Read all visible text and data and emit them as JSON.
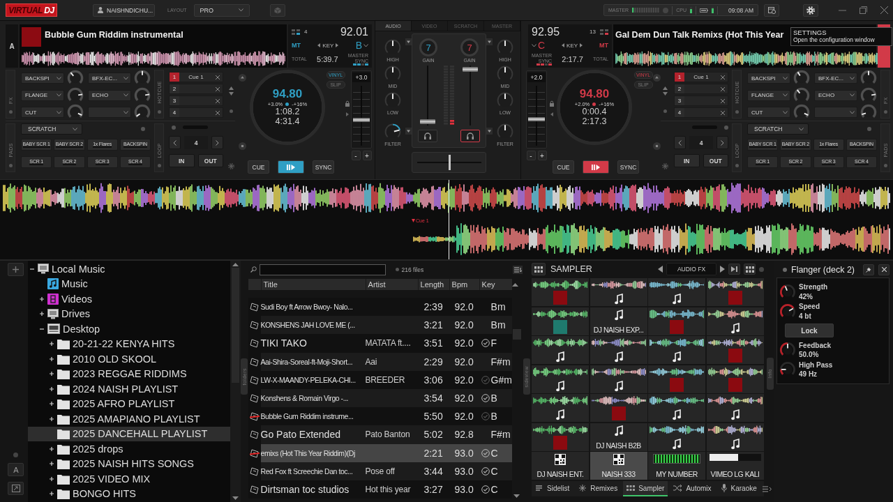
{
  "top_bar": {
    "logo": {
      "main": "VIRTUAL",
      "accent": "DJ"
    },
    "user": "NAISHNDICHU...",
    "layout_label": "LAYOUT",
    "layout": "PRO",
    "master_label": "MASTER",
    "cpu_label": "CPU",
    "time": "09:08 AM",
    "tooltip": {
      "title": "SETTINGS",
      "text": "Open the configuration window"
    }
  },
  "decks": [
    {
      "letter": "A",
      "color": "#2f9fc4",
      "selected": false,
      "cover": true,
      "title": "Bubble Gum Riddim instrumental",
      "beats": "4",
      "bpm": "92.01",
      "mt": "MT",
      "key_label": "KEY",
      "key": "B",
      "total_label": "TOTAL",
      "total": "5:39.7",
      "master_label": "MASTER",
      "sync_label": "SYNC",
      "fx_label": "FX",
      "fx": [
        {
          "name": "BACKSPI",
          "level": 0.35
        },
        {
          "name": "BFX-EC...",
          "level": 0.5
        },
        {
          "name": "FLANGE",
          "level": 0.8
        },
        {
          "name": "ECHO",
          "level": 0.8
        },
        {
          "name": "CUT",
          "level": 0.92
        },
        {
          "level": 0.04
        }
      ],
      "hotcue_label": "HOTCUE",
      "hotcues": [
        {
          "number": "1",
          "label": "Cue 1",
          "set": true
        },
        {
          "number": "2",
          "set": false
        },
        {
          "number": "3",
          "set": false
        },
        {
          "number": "4",
          "set": false
        }
      ],
      "pads_label": "PADS",
      "pad_mode": "SCRATCH",
      "pads": [
        "BABY SCR 1",
        "BABY SCR 2",
        "1x Flares",
        "BACKSPIN",
        "SCR 1",
        "SCR 2",
        "SCR 3",
        "SCR 4"
      ],
      "loop_label": "LOOP",
      "loop_size": "4",
      "loop_in": "IN",
      "loop_out": "OUT",
      "jog": {
        "bpm": "94.80",
        "pitch": "+3.0%",
        "range": "-+16%",
        "elapsed": "1:08.2",
        "remain": "4:31.4"
      },
      "vinyl": {
        "label": "VINYL",
        "on": true
      },
      "slip": {
        "label": "SLIP",
        "on": false
      },
      "pitch_fader": {
        "value": "+3.0",
        "level": 0.42
      },
      "pitch_minus": "-",
      "pitch_plus": "+",
      "cue": "CUE",
      "sync": "SYNC",
      "playing": true
    },
    {
      "color": "#d23a48",
      "selected": true,
      "cover": false,
      "title": "Gal Dem Dun Talk Remixs (Hot This Year",
      "beats": "13",
      "bpm": "92.95",
      "mt": "MT",
      "key_label": "KEY",
      "key": "C",
      "total_label": "TOTAL",
      "total": "2:17.7",
      "master_label": "MASTER",
      "sync_label": "SYNC",
      "fx_label": "FX",
      "fx": [
        {
          "name": "BACKSPI",
          "level": 0.38
        },
        {
          "name": "BFX-EC...",
          "level": 0.5
        },
        {
          "name": "FLANGE",
          "level": 0.36
        },
        {
          "name": "ECHO",
          "level": 0.8
        },
        {
          "name": "CUT",
          "level": 0.92
        },
        {
          "level": 0.1
        }
      ],
      "hotcue_label": "HOTCUE",
      "hotcues": [
        {
          "number": "1",
          "label": "Cue 1",
          "set": true
        },
        {
          "number": "2",
          "set": false
        },
        {
          "number": "3",
          "set": false
        },
        {
          "number": "4",
          "set": false
        }
      ],
      "pads_label": "PADS",
      "pad_mode": "SCRATCH",
      "pads": [
        "BABY SCR 1",
        "BABY SCR 2",
        "1x Flares",
        "BACKSPIN",
        "SCR 1",
        "SCR 2",
        "SCR 3",
        "SCR 4"
      ],
      "loop_label": "LOOP",
      "loop_size": "4",
      "loop_in": "IN",
      "loop_out": "OUT",
      "jog": {
        "bpm": "94.80",
        "pitch": "+2.0%",
        "range": "-+16%",
        "elapsed": "0:00.4",
        "remain": "2:17.3"
      },
      "vinyl": {
        "label": "VINYL",
        "on": true
      },
      "slip": {
        "label": "SLIP",
        "on": false
      },
      "pitch_fader": {
        "value": "+2.0",
        "level": 0.44
      },
      "pitch_minus": "-",
      "pitch_plus": "+",
      "cue": "CUE",
      "sync": "SYNC",
      "playing": true
    }
  ],
  "mixer": {
    "tabs": [
      {
        "label": "AUDIO",
        "selected": true
      },
      {
        "label": "VIDEO",
        "selected": false
      },
      {
        "label": "SCRATCH",
        "selected": false
      },
      {
        "label": "MASTER",
        "selected": false
      }
    ],
    "channels": [
      {
        "eq": [
          {
            "label": "HIGH",
            "level": 0.5
          },
          {
            "label": "MID",
            "level": 0.5
          },
          {
            "label": "LOW",
            "level": 0.5
          },
          {
            "label": "FILTER",
            "level": 0.78
          }
        ],
        "gain_label": "GAIN",
        "gain": "7",
        "volume": {
          "level": 0.02
        },
        "headphone": false
      },
      {
        "eq": [
          {
            "label": "HIGH",
            "level": 0.5
          },
          {
            "label": "MID",
            "level": 0.5
          },
          {
            "label": "LOW",
            "level": 0.5
          },
          {
            "label": "FILTER",
            "level": 0.5
          }
        ],
        "gain_label": "GAIN",
        "gain": "7",
        "volume": {
          "level": 0.98
        },
        "headphone": true
      }
    ],
    "crossfader": {
      "level": 0.5
    }
  },
  "waveforms": {
    "cue_marker": "Cue 1"
  },
  "browser": {
    "font_button": "A",
    "tree": [
      {
        "label": "Local Music",
        "kind": "computer",
        "expanded": true,
        "selected": false,
        "children": [
          {
            "label": "Music",
            "kind": "music",
            "selected": false
          },
          {
            "label": "Videos",
            "kind": "video",
            "expanded": false,
            "selected": false
          },
          {
            "label": "Drives",
            "kind": "computer",
            "expanded": false,
            "selected": false
          },
          {
            "label": "Desktop",
            "kind": "drive",
            "expanded": true,
            "selected": false,
            "children": [
              {
                "label": "20-21-22 KENYA HITS",
                "kind": "folder",
                "expanded": false,
                "selected": false
              },
              {
                "label": "2010 OLD SKOOL",
                "kind": "folder",
                "expanded": false,
                "selected": false
              },
              {
                "label": "2023 REGGAE RIDDIMS",
                "kind": "folder",
                "expanded": false,
                "selected": false
              },
              {
                "label": "2024 NAISH PLAYLIST",
                "kind": "folder",
                "expanded": false,
                "selected": false
              },
              {
                "label": "2025 AFRO PLAYLIST",
                "kind": "folder",
                "expanded": false,
                "selected": false
              },
              {
                "label": "2025 AMAPIANO PLAYLIST",
                "kind": "folder",
                "expanded": false,
                "selected": false
              },
              {
                "label": "2025 DANCEHALL PLAYLIST",
                "kind": "folder",
                "selected": true
              },
              {
                "label": "2025 drops",
                "kind": "folder",
                "expanded": false,
                "selected": false
              },
              {
                "label": "2025 NAISH HITS SONGS",
                "kind": "folder",
                "expanded": false,
                "selected": false
              },
              {
                "label": "2025 VIDEO MIX",
                "kind": "folder",
                "expanded": false,
                "selected": false
              },
              {
                "label": "BONGO HITS",
                "kind": "folder",
                "expanded": false,
                "selected": false
              }
            ]
          }
        ]
      }
    ],
    "folders_tab": "folders",
    "file_count": "216 files",
    "columns": [
      "Title",
      "Artist",
      "Length",
      "Bpm",
      "Key"
    ],
    "rows": [
      {
        "title": "Sudi Boy ft Arrow Bwoy- Nalo...",
        "length": "2:39",
        "bpm": "92.0",
        "key": "Bm",
        "checked": false,
        "loaded": false,
        "selected": false
      },
      {
        "title": "KONSHENS JAH LOVE ME (...",
        "length": "3:21",
        "bpm": "92.0",
        "key": "Bm",
        "checked": false,
        "loaded": false,
        "selected": false
      },
      {
        "title": "TIKI TAKO",
        "artist": "MATATA ft....",
        "length": "3:51",
        "bpm": "92.0",
        "key": "F",
        "checked": true,
        "dimmed": false,
        "loaded": false,
        "selected": false
      },
      {
        "title": "Aai-Shira-Soreal-ft-Moji-Short...",
        "artist": "Aai",
        "length": "2:29",
        "bpm": "92.0",
        "key": "F#m",
        "checked": false,
        "loaded": false,
        "selected": false
      },
      {
        "title": "LW-X-MAANDY-PELEKA-CHI...",
        "artist": "BREEDER",
        "length": "3:06",
        "bpm": "92.0",
        "key": "G#m",
        "checked": true,
        "dimmed": true,
        "loaded": false,
        "selected": false
      },
      {
        "title": "Konshens & Romain Virgo -...",
        "length": "3:54",
        "bpm": "92.0",
        "key": "B",
        "checked": true,
        "dimmed": false,
        "loaded": false,
        "selected": false
      },
      {
        "title": "Bubble Gum Riddim instrume...",
        "length": "5:50",
        "bpm": "92.0",
        "key": "B",
        "checked": true,
        "dimmed": true,
        "loaded": true,
        "selected": false
      },
      {
        "title": "Go Pato Extended",
        "artist": "Pato Banton",
        "length": "5:02",
        "bpm": "92.8",
        "key": "F#m",
        "checked": false,
        "loaded": false,
        "selected": false
      },
      {
        "title": "emixs (Hot This Year Riddim)(Dj",
        "length": "2:21",
        "bpm": "93.0",
        "key": "C",
        "checked": true,
        "dimmed": false,
        "loaded": true,
        "selected": true
      },
      {
        "title": "Red Fox ft Screechie Dan toc...",
        "artist": "Pose off",
        "length": "3:44",
        "bpm": "93.0",
        "key": "C",
        "checked": true,
        "dimmed": false,
        "loaded": false,
        "selected": false
      },
      {
        "title": "Dirtsman toc studios",
        "artist": "Hot this year",
        "length": "3:27",
        "bpm": "93.0",
        "key": "C",
        "checked": true,
        "dimmed": false,
        "loaded": false,
        "selected": false
      }
    ],
    "sideview_tab": "sideview"
  },
  "sampler": {
    "title": "SAMPLER",
    "bank": "AUDIO FX",
    "tiles": [
      {
        "kind": "cover",
        "color": "#8b0a10",
        "wave": true,
        "selected": false
      },
      {
        "kind": "note",
        "wave": true,
        "selected": false
      },
      {
        "kind": "note",
        "wave": true,
        "selected": false
      },
      {
        "kind": "cover",
        "color": "#8b0a10",
        "wave": true,
        "selected": false
      },
      {
        "kind": "cover",
        "color": "#1f7a6e",
        "wave": true,
        "selected": false
      },
      {
        "kind": "note",
        "label": "DJ NAISH EXP...",
        "wave": false,
        "selected": false
      },
      {
        "kind": "cover",
        "color": "#8b0a10",
        "wave": true,
        "selected": false
      },
      {
        "kind": "note",
        "wave": true,
        "selected": false
      },
      {
        "kind": "note",
        "wave": true,
        "selected": false
      },
      {
        "kind": "note",
        "wave": true,
        "selected": false
      },
      {
        "kind": "note",
        "wave": true,
        "selected": false
      },
      {
        "kind": "cover",
        "color": "#8b0a10",
        "wave": true,
        "selected": false
      },
      {
        "kind": "note",
        "wave": true,
        "selected": false
      },
      {
        "kind": "note",
        "wave": true,
        "selected": false
      },
      {
        "kind": "cover",
        "color": "#8b0a10",
        "wave": true,
        "selected": false
      },
      {
        "kind": "cover",
        "color": "#8b0a10",
        "wave": true,
        "selected": false
      },
      {
        "kind": "note",
        "wave": true,
        "selected": false
      },
      {
        "kind": "cover",
        "color": "#8b0a10",
        "wave": true,
        "selected": false
      },
      {
        "kind": "note",
        "wave": true,
        "selected": false
      },
      {
        "kind": "note",
        "wave": true,
        "selected": false
      },
      {
        "kind": "cover",
        "color": "#8b0a10",
        "wave": true,
        "selected": false
      },
      {
        "kind": "note",
        "label": "DJ NAISH B2B",
        "wave": false,
        "selected": false
      },
      {
        "kind": "note",
        "wave": true,
        "selected": false
      },
      {
        "kind": "note",
        "wave": true,
        "selected": false
      },
      {
        "kind": "qr",
        "label": "DJ NAISH ENT.",
        "wave": false,
        "selected": false
      },
      {
        "kind": "qr",
        "label": "NAISH 333",
        "wave": false,
        "selected": true
      },
      {
        "kind": "screen",
        "label": "MY NUMBER",
        "wave": false,
        "selected": false
      },
      {
        "kind": "bar",
        "label": "VIMEO LG KALI",
        "wave": false,
        "selected": false
      }
    ],
    "tabs": [
      {
        "kind": "list",
        "label": "Sidelist",
        "selected": false
      },
      {
        "kind": "remix",
        "label": "Remixes",
        "selected": false
      },
      {
        "kind": "grid",
        "label": "Sampler",
        "selected": true
      },
      {
        "kind": "shuffle",
        "label": "Automix",
        "selected": false
      },
      {
        "kind": "mic",
        "label": "Karaoke",
        "selected": false
      }
    ],
    "info_tab": "Info"
  },
  "fx_panel": {
    "title": "Flanger (deck 2)",
    "params": [
      {
        "kind": "knob",
        "label": "Strength",
        "value": "42%",
        "level": 0.42
      },
      {
        "kind": "knob",
        "label": "Speed",
        "value": "4 bt",
        "level": 0.72
      },
      {
        "kind": "button",
        "label": "Lock"
      },
      {
        "kind": "knob",
        "label": "Feedback",
        "value": "50.0%",
        "level": 0.5
      },
      {
        "kind": "knob",
        "label": "High Pass",
        "value": "49 Hz",
        "level": 0.17
      }
    ]
  }
}
